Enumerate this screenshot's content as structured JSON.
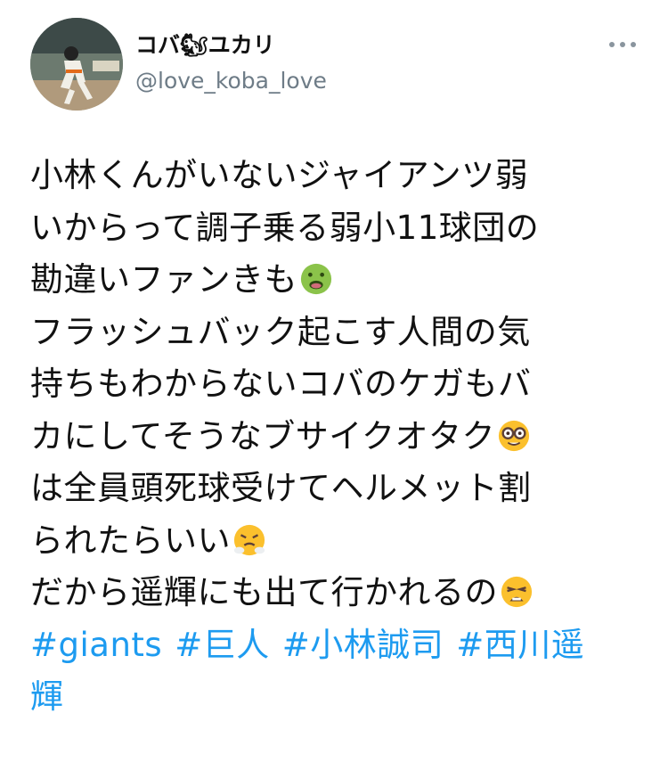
{
  "tweet": {
    "user": {
      "display_name": "コバ🐿ユカリ",
      "handle": "@love_koba_love",
      "avatar_icon": "baseball-player-avatar"
    },
    "more_icon": "ellipsis-icon",
    "body_lines": [
      "小林くんがいないジャイアンツ弱",
      "いからって調子乗る弱小11球団の",
      "勘違いファンきも",
      "フラッシュバック起こす人間の気",
      "持ちもわからないコバのケガもバ",
      "カにしてそうなブサイクオタク",
      "は全員頭死球受けてヘルメット割",
      "られたらいい",
      "だから遥輝にも出て行かれるの"
    ],
    "emojis": {
      "line3": "nauseated-face-emoji",
      "line6": "nerd-face-emoji",
      "line8": "face-with-steam-emoji",
      "line9": "weary-face-emoji"
    },
    "hashtags": [
      "#giants",
      "#巨人",
      "#小林誠司",
      "#西川遥"
    ],
    "hashtag_continuation": "輝",
    "colors": {
      "text": "#111111",
      "handle": "#6e7c87",
      "hashtag": "#1d9bf0",
      "background": "#ffffff"
    }
  }
}
